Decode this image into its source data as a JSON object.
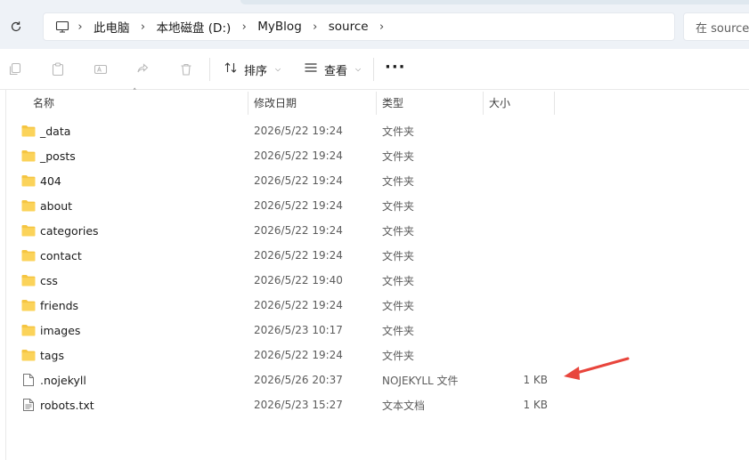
{
  "breadcrumb": [
    "此电脑",
    "本地磁盘 (D:)",
    "MyBlog",
    "source"
  ],
  "search": {
    "placeholder": "在 source"
  },
  "toolbar": {
    "sort_label": "排序",
    "view_label": "查看",
    "more_label": "···"
  },
  "columns": {
    "name": "名称",
    "date": "修改日期",
    "type": "类型",
    "size": "大小"
  },
  "files": [
    {
      "name": "_data",
      "date": "2026/5/22 19:24",
      "type": "文件夹",
      "size": "",
      "icon": "folder-icon"
    },
    {
      "name": "_posts",
      "date": "2026/5/22 19:24",
      "type": "文件夹",
      "size": "",
      "icon": "folder-icon"
    },
    {
      "name": "404",
      "date": "2026/5/22 19:24",
      "type": "文件夹",
      "size": "",
      "icon": "folder-icon"
    },
    {
      "name": "about",
      "date": "2026/5/22 19:24",
      "type": "文件夹",
      "size": "",
      "icon": "folder-icon"
    },
    {
      "name": "categories",
      "date": "2026/5/22 19:24",
      "type": "文件夹",
      "size": "",
      "icon": "folder-icon"
    },
    {
      "name": "contact",
      "date": "2026/5/22 19:24",
      "type": "文件夹",
      "size": "",
      "icon": "folder-icon"
    },
    {
      "name": "css",
      "date": "2026/5/22 19:40",
      "type": "文件夹",
      "size": "",
      "icon": "folder-icon"
    },
    {
      "name": "friends",
      "date": "2026/5/22 19:24",
      "type": "文件夹",
      "size": "",
      "icon": "folder-icon"
    },
    {
      "name": "images",
      "date": "2026/5/23 10:17",
      "type": "文件夹",
      "size": "",
      "icon": "folder-icon"
    },
    {
      "name": "tags",
      "date": "2026/5/22 19:24",
      "type": "文件夹",
      "size": "",
      "icon": "folder-icon"
    },
    {
      "name": ".nojekyll",
      "date": "2026/5/26 20:37",
      "type": "NOJEKYLL 文件",
      "size": "1 KB",
      "icon": "blank-file-icon"
    },
    {
      "name": "robots.txt",
      "date": "2026/5/23 15:27",
      "type": "文本文档",
      "size": "1 KB",
      "icon": "text-file-icon"
    }
  ],
  "colors": {
    "folder": "#f5c542",
    "arrow": "#e8453c"
  }
}
